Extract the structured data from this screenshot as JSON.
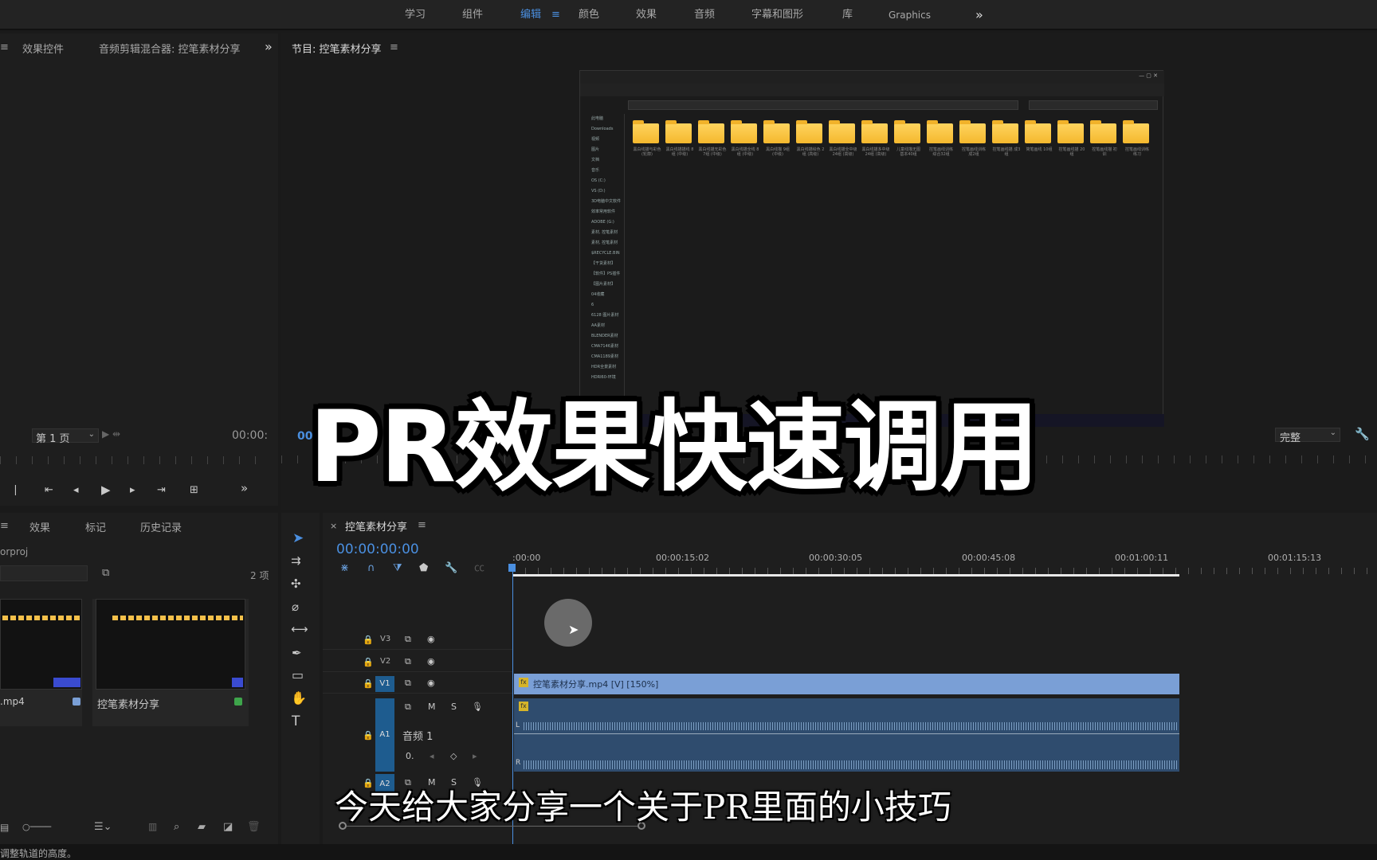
{
  "workspaces": {
    "items": [
      "学习",
      "组件",
      "编辑",
      "颜色",
      "效果",
      "音频",
      "字幕和图形",
      "库",
      "Graphics"
    ],
    "active_index": 2,
    "more": "»"
  },
  "left_top": {
    "tabs": [
      "效果控件",
      "音频剪辑混合器: 控笔素材分享"
    ],
    "more": "»",
    "page_select": "第 1 页",
    "timecode": "00:00:"
  },
  "program": {
    "title": "节目: 控笔素材分享",
    "timecode_right": "00",
    "fit_select": "完整",
    "screen": {
      "folder_names": [
        "黑白线描与彩色 (轮廓)",
        "黑白线描描线 8组 (中级)",
        "黑白线描无彩色 7组 (中级)",
        "黑白线描全线 8组 (中级)",
        "黑白线描 9组 (中级)",
        "黑白线描绘色 2组 (高级)",
        "黑白线描全中级 24组 (高级)",
        "黑白线描多中级 24组 (高级)",
        "儿童线描无图 基本40组",
        "控笔画线训练 综合32组",
        "控笔画线训练 成2组",
        "控笔画线描 成3组",
        "简笔画线 10组",
        "控笔画线描 20组",
        "控笔画线描 初训",
        "控笔画线训练 练习"
      ],
      "nav_items": [
        "此电脑",
        "Downloads",
        "视频",
        "图片",
        "文档",
        "音乐",
        "OS (C:)",
        "VS (D:)",
        "3D电脑中文软件",
        "效率常用软件",
        "ADOBE (G:)",
        "素材, 控笔素材",
        "素材, 控笔素材",
        "$RECYCLE.BIN",
        "【干货素材】",
        "【软件】PS插件",
        "【图片素材】",
        "04收藏",
        "6",
        "6128 图片素材",
        "AA素材",
        "BLENDER素材",
        "CMA7146素材",
        "CMA1189素材",
        "HDR全景素材",
        "HDRI60-环境"
      ]
    }
  },
  "title_overlay": "PR效果快速调用",
  "subtitle": "今天给大家分享一个关于PR里面的小技巧",
  "project_panel": {
    "tabs": [
      "效果",
      "标记",
      "历史记录"
    ],
    "project_name": "orproj",
    "item_count": "2 项",
    "items": [
      {
        "name": ".mp4",
        "badge_color": "#7a9fd6"
      },
      {
        "name": "控笔素材分享",
        "badge_color": "#3ea54b"
      }
    ]
  },
  "timeline": {
    "tab": "控笔素材分享",
    "timecode": "00:00:00:00",
    "ruler_labels": [
      ":00:00",
      "00:00:15:02",
      "00:00:30:05",
      "00:00:45:08",
      "00:01:00:11",
      "00:01:15:13"
    ],
    "tracks": [
      {
        "id": "V3"
      },
      {
        "id": "V2"
      },
      {
        "id": "V1"
      },
      {
        "id": "A1",
        "name": "音频 1"
      },
      {
        "id": "A2"
      }
    ],
    "video_clip": "控笔素材分享.mp4 [V] [150%]",
    "audio_channels": [
      "L",
      "R"
    ],
    "audio_value": "0."
  },
  "status": "调整轨道的高度。",
  "colors": {
    "accent": "#4a8fe0",
    "clip_video": "#7a9fd6",
    "clip_audio": "#2f4c6e",
    "track_active": "#1e5c8f"
  }
}
